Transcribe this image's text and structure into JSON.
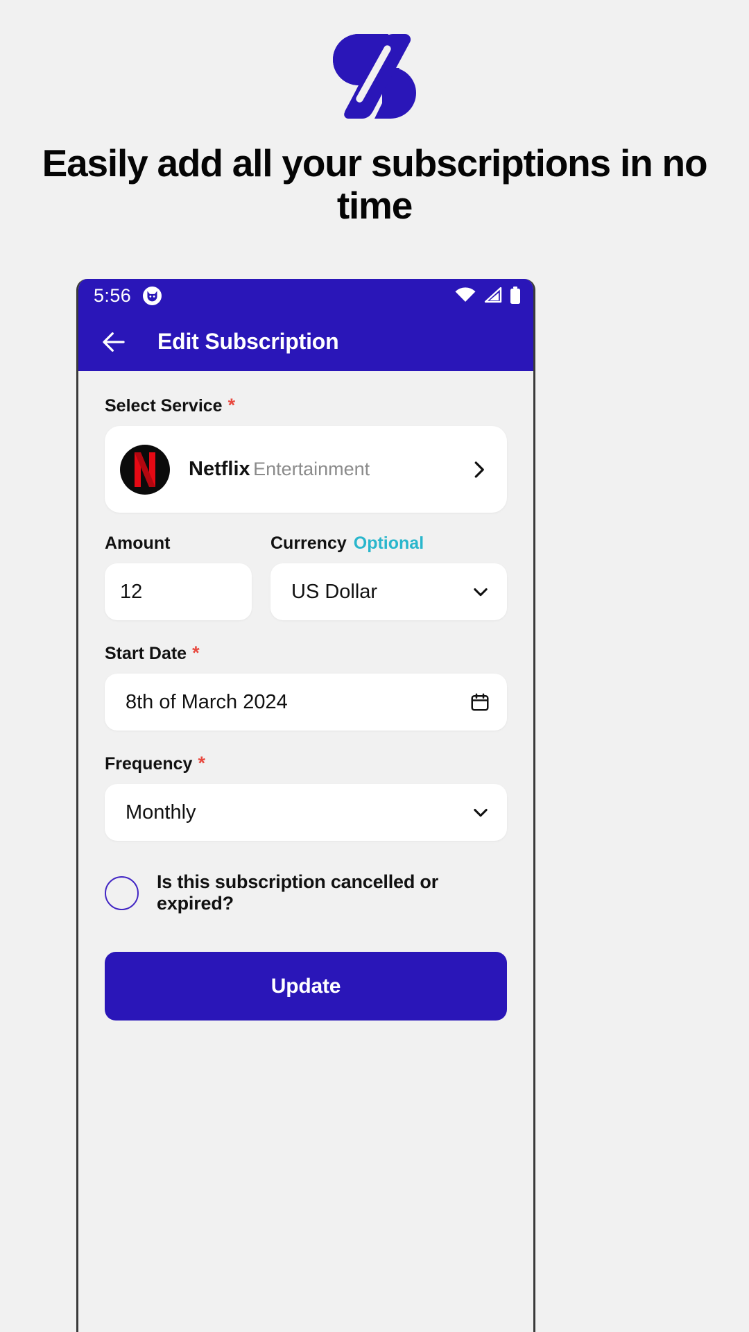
{
  "brand": {
    "logo_icon": "zeta-slash-logo",
    "color": "#2a16b8"
  },
  "headline": "Easily add all your subscriptions in no time",
  "phone": {
    "status_bar": {
      "time": "5:56",
      "app_icon": "cat-face-icon",
      "wifi_icon": "wifi-icon",
      "signal_icon": "cellular-signal-icon",
      "battery_icon": "battery-icon"
    },
    "app_bar": {
      "back_icon": "arrow-left-icon",
      "title": "Edit Subscription"
    },
    "form": {
      "service": {
        "label": "Select Service",
        "required_mark": "*",
        "name": "Netflix",
        "category": "Entertainment",
        "logo_icon": "netflix-logo",
        "chevron_icon": "chevron-right-icon"
      },
      "amount": {
        "label": "Amount",
        "value": "12"
      },
      "currency": {
        "label": "Currency",
        "optional_text": "Optional",
        "value": "US Dollar",
        "chevron_icon": "chevron-down-icon"
      },
      "start_date": {
        "label": "Start Date",
        "required_mark": "*",
        "value": "8th of March 2024",
        "icon": "calendar-icon"
      },
      "frequency": {
        "label": "Frequency",
        "required_mark": "*",
        "value": "Monthly",
        "chevron_icon": "chevron-down-icon"
      },
      "cancelled_checkbox": {
        "label": "Is this subscription cancelled or expired?",
        "checked": false
      },
      "submit": {
        "label": "Update"
      }
    }
  },
  "colors": {
    "primary": "#2a16b8",
    "accent_teal": "#29b6cc",
    "required_red": "#e8493f",
    "page_bg": "#f1f1f1"
  }
}
